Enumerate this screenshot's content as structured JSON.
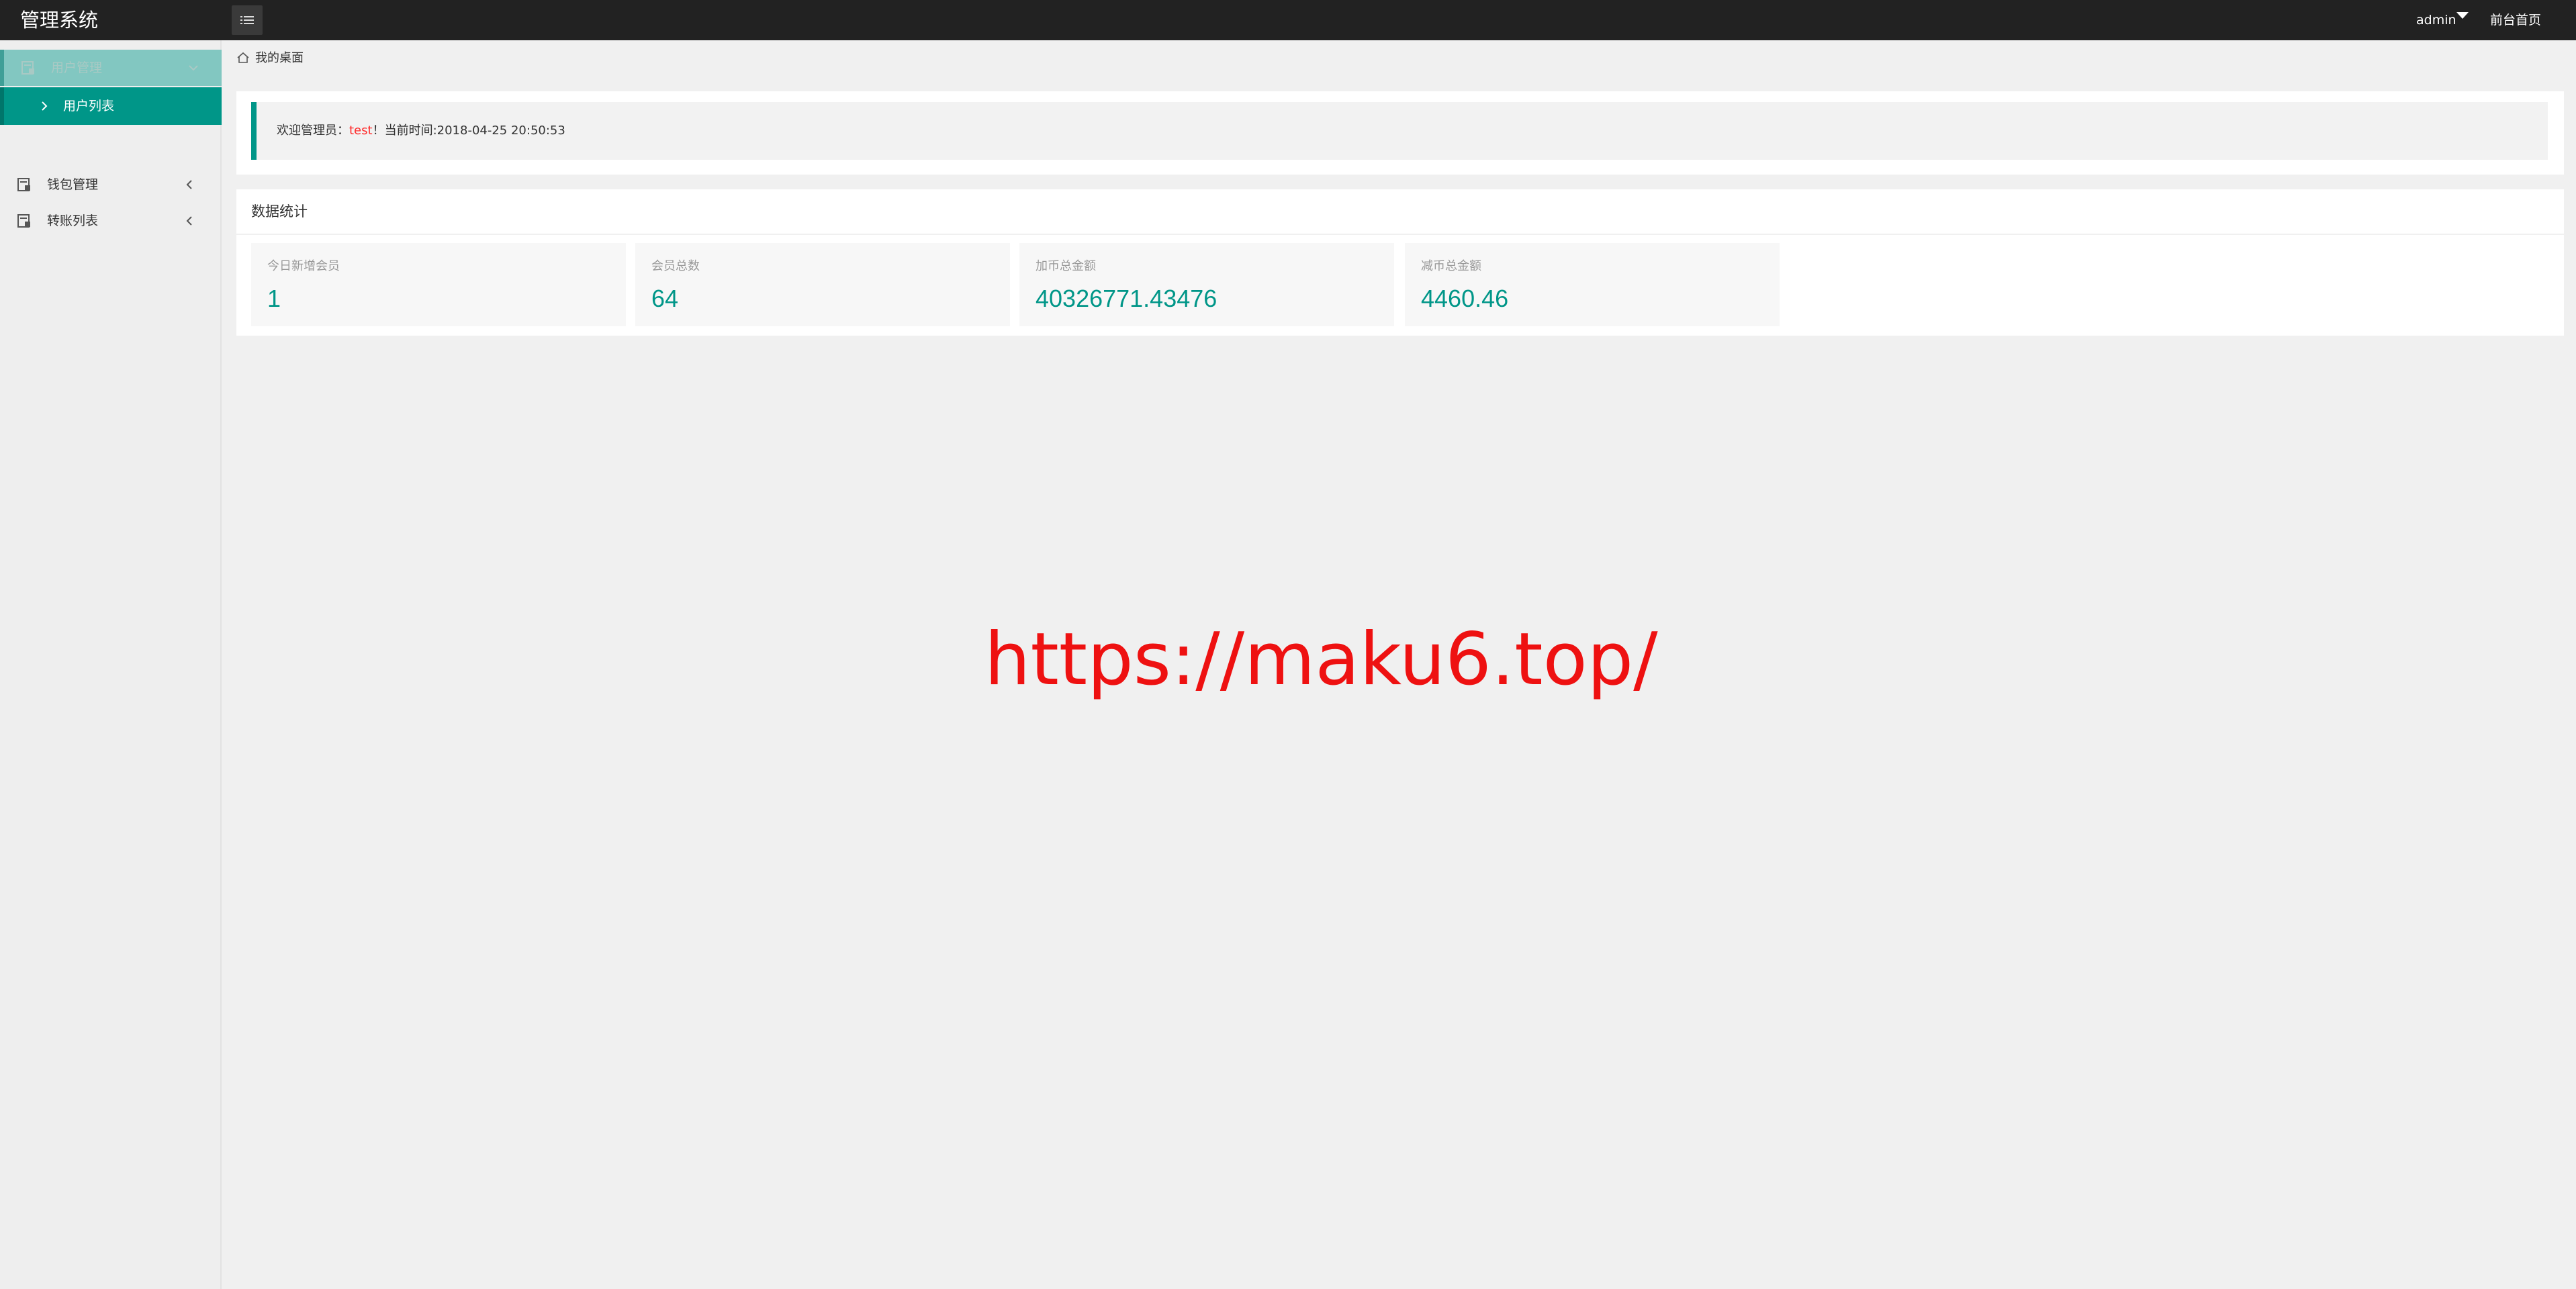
{
  "app": {
    "title": "管理系统"
  },
  "header": {
    "user_label": "admin",
    "front_link": "前台首页"
  },
  "sidebar": {
    "items": [
      {
        "label": "用户管理",
        "icon": "folder-icon",
        "expanded": true
      },
      {
        "label": "用户列表",
        "active": true
      },
      {
        "label": "钱包管理",
        "icon": "folder-icon"
      },
      {
        "label": "转账列表",
        "icon": "folder-icon"
      }
    ]
  },
  "breadcrumb": {
    "label": "我的桌面"
  },
  "welcome": {
    "prefix": "欢迎管理员：",
    "username": "test",
    "suffix": "！当前时间:2018-04-25 20:50:53"
  },
  "stats": {
    "title": "数据统计",
    "cards": [
      {
        "label": "今日新增会员",
        "value": "1"
      },
      {
        "label": "会员总数",
        "value": "64"
      },
      {
        "label": "加币总金额",
        "value": "40326771.43476"
      },
      {
        "label": "减币总金额",
        "value": "4460.46"
      }
    ]
  },
  "watermark": {
    "text": "https://maku6.top/"
  },
  "colors": {
    "topbar": "#222222",
    "accent": "#009688",
    "highlight": "#ff2a2a",
    "watermark": "#ee1111"
  }
}
